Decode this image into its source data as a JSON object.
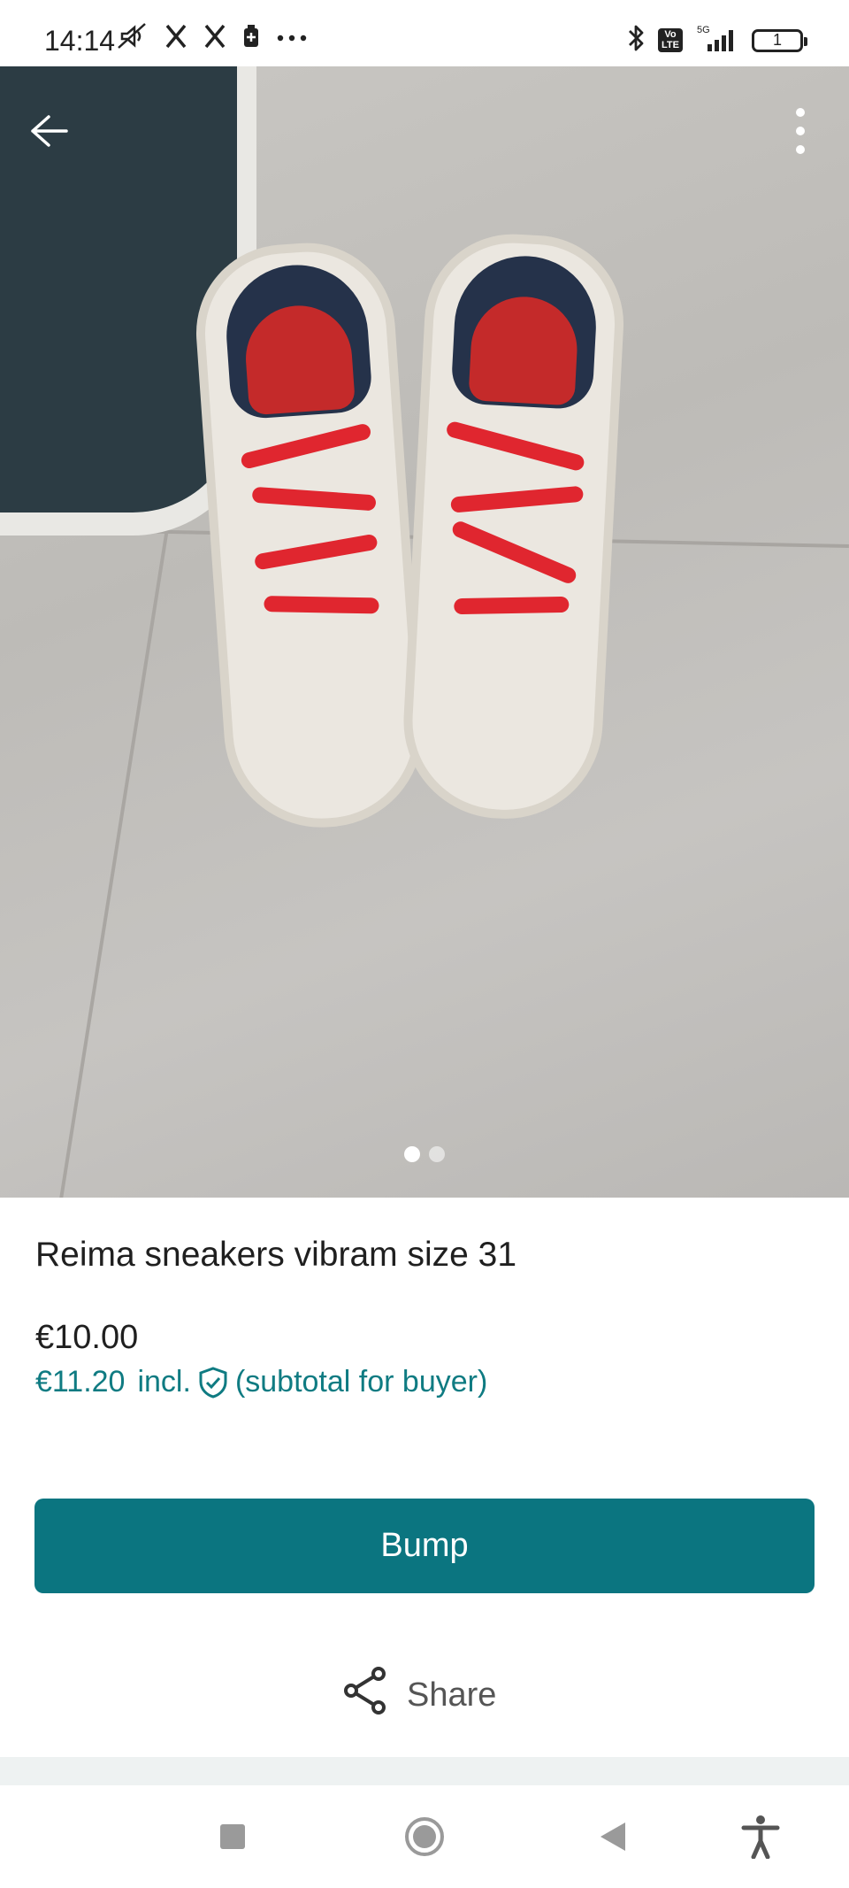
{
  "status_bar": {
    "time": "14:14",
    "icons": [
      "mute-icon",
      "x-icon",
      "x-icon",
      "battery-saver-icon",
      "more-dots-icon",
      "bluetooth-icon",
      "volte-icon",
      "signal-5g-icon",
      "battery-icon"
    ],
    "volte_label": "Vo\nLTE",
    "network": "5G",
    "battery_level": "1"
  },
  "photo": {
    "page_count": 2,
    "active_page": 1
  },
  "listing": {
    "title": "Reima sneakers vibram size 31",
    "price": "€10.00",
    "buyer_price": "€11.20",
    "buyer_incl": "incl.",
    "buyer_note": "(subtotal for buyer)"
  },
  "actions": {
    "bump_label": "Bump",
    "share_label": "Share"
  },
  "colors": {
    "accent": "#0b7580",
    "buyer_text": "#0f7b82"
  },
  "nav": [
    "recents-square-icon",
    "home-circle-icon",
    "back-triangle-icon",
    "accessibility-icon"
  ]
}
